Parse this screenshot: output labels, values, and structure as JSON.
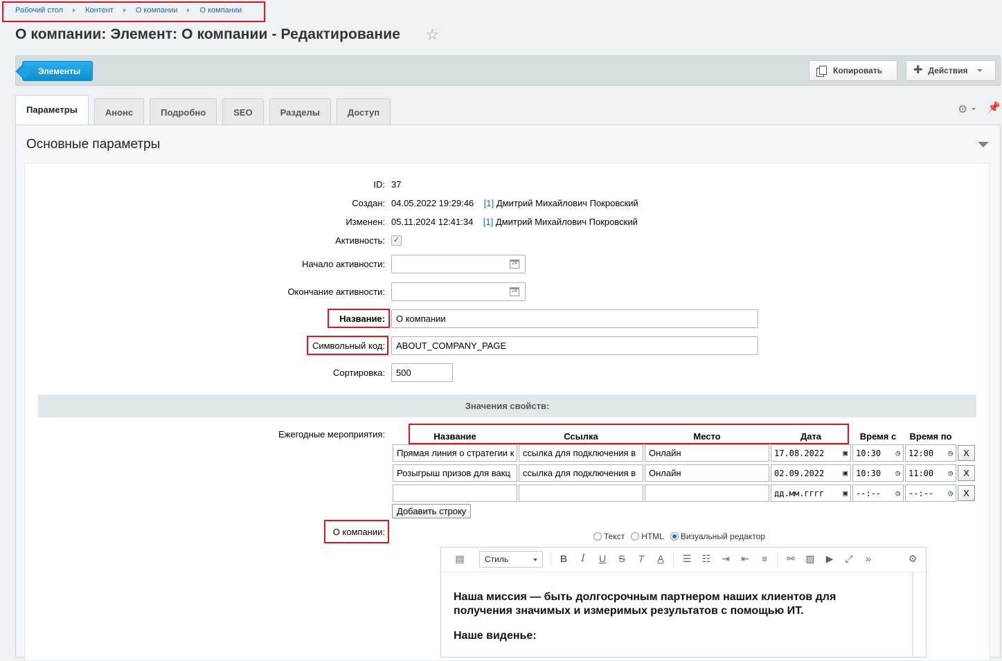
{
  "breadcrumb": [
    "Рабочий стол",
    "Контент",
    "О компании",
    "О компании"
  ],
  "page_title": "О компании: Элемент: О компании - Редактирование",
  "toolbar": {
    "elements_label": "Элементы",
    "copy_label": "Копировать",
    "actions_label": "Действия"
  },
  "tabs": [
    "Параметры",
    "Анонс",
    "Подробно",
    "SEO",
    "Разделы",
    "Доступ"
  ],
  "section_title": "Основные параметры",
  "fields": {
    "id_label": "ID:",
    "id_value": "37",
    "created_label": "Создан:",
    "created_value": "04.05.2022 19:29:46",
    "created_user_link": "[1]",
    "created_user": "Дмитрий Михайлович Покровский",
    "modified_label": "Изменен:",
    "modified_value": "05.11.2024 12:41:34",
    "modified_user_link": "[1]",
    "modified_user": "Дмитрий Михайлович Покровский",
    "active_label": "Активность:",
    "active_check": "✓",
    "active_from_label": "Начало активности:",
    "active_to_label": "Окончание активности:",
    "calendar_day": "24",
    "name_label": "Название:",
    "name_value": "О компании",
    "code_label": "Символьный код:",
    "code_value": "ABOUT_COMPANY_PAGE",
    "sort_label": "Сортировка:",
    "sort_value": "500"
  },
  "props_header": "Значения свойств:",
  "events": {
    "label": "Ежегодные мероприятия:",
    "columns": [
      "Название",
      "Ссылка",
      "Место",
      "Дата",
      "Время с",
      "Время по"
    ],
    "rows": [
      {
        "name": "Прямая линия о стратегии к",
        "link": "ссылка для подключения в",
        "place": "Онлайн",
        "date": "17.08.2022",
        "from": "10:30",
        "to": "12:00",
        "delete": "X"
      },
      {
        "name": "Розыгрыш призов для вакц",
        "link": "ссылка для подключения в",
        "place": "Онлайн",
        "date": "02.09.2022",
        "from": "10:30",
        "to": "11:00",
        "delete": "X"
      },
      {
        "name": "",
        "link": "",
        "place": "",
        "date": "дд.мм.гггг",
        "from": "--:--",
        "to": "--:--",
        "delete": "X"
      }
    ],
    "add_row_label": "Добавить строку"
  },
  "about": {
    "label": "О компании:",
    "modes": [
      "Текст",
      "HTML",
      "Визуальный редактор"
    ],
    "selected_mode": "Визуальный редактор",
    "style_select": "Стиль",
    "body_paragraphs": [
      "Наша миссия — быть долгосрочным партнером наших клиентов для получения значимых и измеримых результатов с помощью ИТ.",
      "Наше виденье:"
    ]
  },
  "colors": {
    "highlight": "#e8121e",
    "primary_button": "#1ba2e0",
    "link": "#2067b0"
  }
}
